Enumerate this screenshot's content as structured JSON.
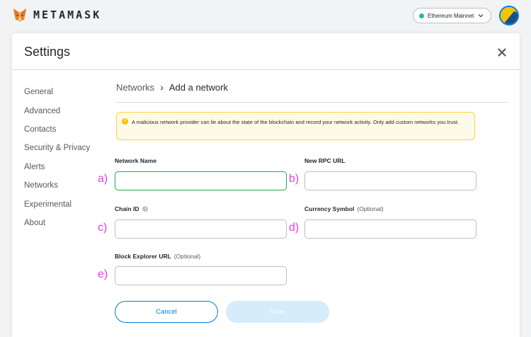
{
  "app": {
    "brand": "METAMASK"
  },
  "network": {
    "label": "Ethereum Mainnet",
    "dot_color": "#29b6af"
  },
  "settings": {
    "title": "Settings"
  },
  "sidebar": {
    "items": [
      {
        "label": "General"
      },
      {
        "label": "Advanced"
      },
      {
        "label": "Contacts"
      },
      {
        "label": "Security & Privacy"
      },
      {
        "label": "Alerts"
      },
      {
        "label": "Networks"
      },
      {
        "label": "Experimental"
      },
      {
        "label": "About"
      }
    ]
  },
  "breadcrumb": {
    "parent": "Networks",
    "separator": "›",
    "current": "Add a network"
  },
  "warning": {
    "text": "A malicious network provider can lie about the state of the blockchain and record your network activity. Only add custom networks you trust."
  },
  "form": {
    "network_name": {
      "label": "Network Name",
      "value": "",
      "marker": "a)"
    },
    "rpc_url": {
      "label": "New RPC URL",
      "value": "",
      "marker": "b)"
    },
    "chain_id": {
      "label": "Chain ID",
      "value": "",
      "marker": "c)"
    },
    "currency_symbol": {
      "label": "Currency Symbol",
      "optional": "(Optional)",
      "value": "",
      "marker": "d)"
    },
    "block_explorer": {
      "label": "Block Explorer URL",
      "optional": "(Optional)",
      "value": "",
      "marker": "e)"
    }
  },
  "buttons": {
    "cancel": "Cancel",
    "save": "Save"
  },
  "colors": {
    "accent": "#037dd6",
    "warning_bg": "#fefae8",
    "warning_border": "#ffd33d",
    "focus": "#28a745",
    "marker": "#e83fe0"
  }
}
